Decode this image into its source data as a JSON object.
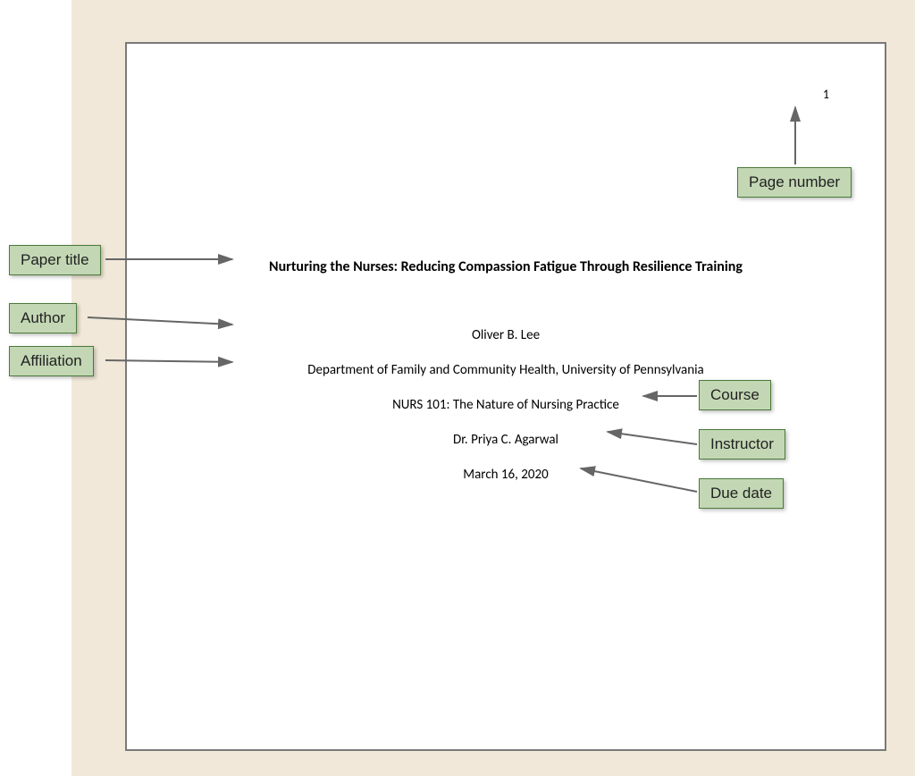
{
  "page_number": "1",
  "paper": {
    "title": "Nurturing the Nurses: Reducing Compassion Fatigue Through Resilience Training",
    "author": "Oliver B. Lee",
    "affiliation": "Department of Family and Community Health, University of Pennsylvania",
    "course": "NURS 101: The Nature of Nursing Practice",
    "instructor": "Dr. Priya C. Agarwal",
    "due_date": "March 16, 2020"
  },
  "labels": {
    "paper_title": "Paper title",
    "author": "Author",
    "affiliation": "Affiliation",
    "page_number": "Page number",
    "course": "Course",
    "instructor": "Instructor",
    "due_date": "Due date"
  }
}
